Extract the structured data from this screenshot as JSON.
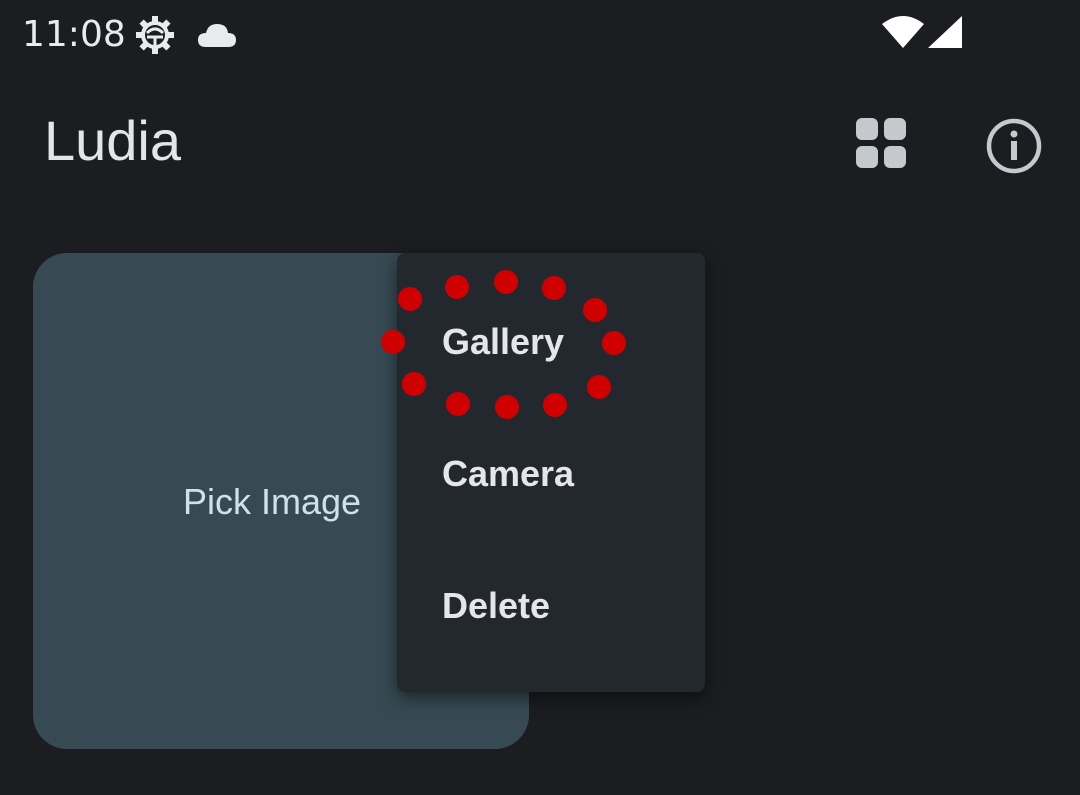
{
  "status_bar": {
    "time": "11:08",
    "icons": [
      "gear-icon",
      "cloud-icon",
      "wifi-icon",
      "signal-icon"
    ]
  },
  "app_bar": {
    "title": "Ludia",
    "actions": [
      "grid-view-icon",
      "info-icon"
    ]
  },
  "card": {
    "label": "Pick Image"
  },
  "menu": {
    "items": [
      {
        "label": "Gallery"
      },
      {
        "label": "Camera"
      },
      {
        "label": "Delete"
      }
    ]
  },
  "colors": {
    "background": "#1b1d20",
    "card": "#374a53",
    "menu": "#23282e",
    "highlight": "#d00000"
  }
}
